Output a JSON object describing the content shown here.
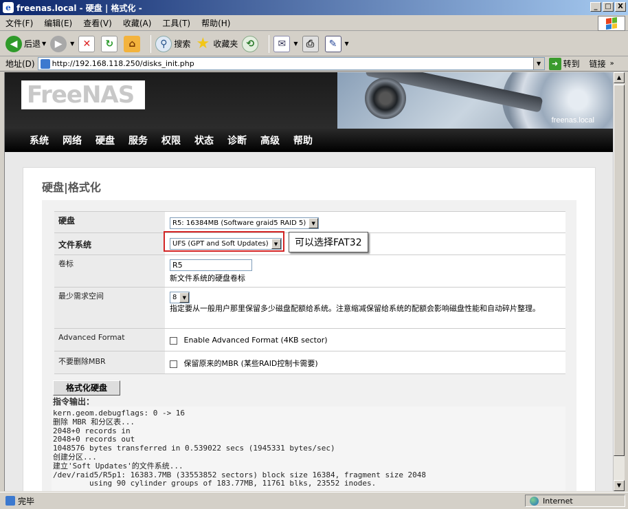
{
  "window": {
    "title": "freenas.local - 硬盘 | 格式化 -",
    "controls": [
      "_",
      "□",
      "X"
    ]
  },
  "menu": [
    "文件(F)",
    "编辑(E)",
    "查看(V)",
    "收藏(A)",
    "工具(T)",
    "帮助(H)"
  ],
  "toolbar": {
    "back": "后退",
    "search": "搜索",
    "favorites": "收藏夹"
  },
  "address": {
    "label": "地址(D)",
    "url": "http://192.168.118.250/disks_init.php",
    "go": "转到",
    "links": "链接"
  },
  "header": {
    "logo": "FreeNAS",
    "hostname": "freenas.local"
  },
  "nav": [
    "系统",
    "网络",
    "硬盘",
    "服务",
    "权限",
    "状态",
    "诊断",
    "高级",
    "帮助"
  ],
  "page": {
    "title": "硬盘|格式化"
  },
  "form": {
    "disk": {
      "label": "硬盘",
      "value": "R5: 16384MB (Software graid5 RAID 5)"
    },
    "filesystem": {
      "label": "文件系统",
      "value": "UFS (GPT and Soft Updates)"
    },
    "volume": {
      "label": "卷标",
      "value": "R5",
      "help": "新文件系统的硬盘卷标"
    },
    "minspace": {
      "label": "最少需求空间",
      "value": "8",
      "help": "指定要从一般用户那里保留多少磁盘配额给系统。注意缩减保留给系统的配额会影响磁盘性能和自动碎片整理。"
    },
    "advformat": {
      "label": "Advanced Format",
      "checkbox": "Enable Advanced Format (4KB sector)"
    },
    "mbr": {
      "label": "不要删除MBR",
      "checkbox": "保留原来的MBR (某些RAID控制卡需要)"
    },
    "submit": "格式化硬盘"
  },
  "callout": "可以选择FAT32",
  "output": {
    "label": "指令输出：",
    "lines": [
      "kern.geom.debugflags: 0 -> 16",
      "删除 MBR 和分区表...",
      "2048+0 records in",
      "2048+0 records out",
      "1048576 bytes transferred in 0.539022 secs (1945331 bytes/sec)",
      "创建分区...",
      "建立'Soft Updates'的文件系统...",
      "/dev/raid5/R5p1: 16383.7MB (33553852 sectors) block size 16384, fragment size 2048",
      "        using 90 cylinder groups of 183.77MB, 11761 blks, 23552 inodes."
    ]
  },
  "status": {
    "text": "完毕",
    "zone": "Internet"
  }
}
